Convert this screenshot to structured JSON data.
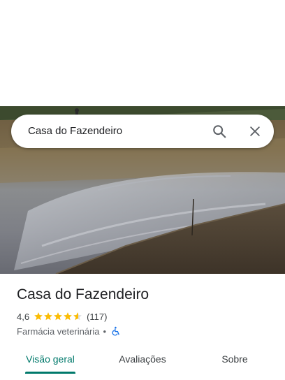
{
  "search": {
    "query": "Casa do Fazendeiro"
  },
  "icons": {
    "search": "search-icon",
    "close": "close-icon",
    "star": "star-icon",
    "accessibility": "wheelchair-icon"
  },
  "place": {
    "name": "Casa do Fazendeiro",
    "rating": "4,6",
    "rating_numeric": 4.6,
    "stars_max": 5,
    "review_count": "(117)",
    "category": "Farmácia veterinária",
    "separator": "•"
  },
  "tabs": [
    {
      "label": "Visão geral",
      "active": true
    },
    {
      "label": "Avaliações",
      "active": false
    },
    {
      "label": "Sobre",
      "active": false
    }
  ],
  "colors": {
    "accent": "#00796b",
    "star": "#fbbc04",
    "accessibility": "#1a73e8",
    "text_primary": "#202124",
    "text_secondary": "#5f6368"
  }
}
